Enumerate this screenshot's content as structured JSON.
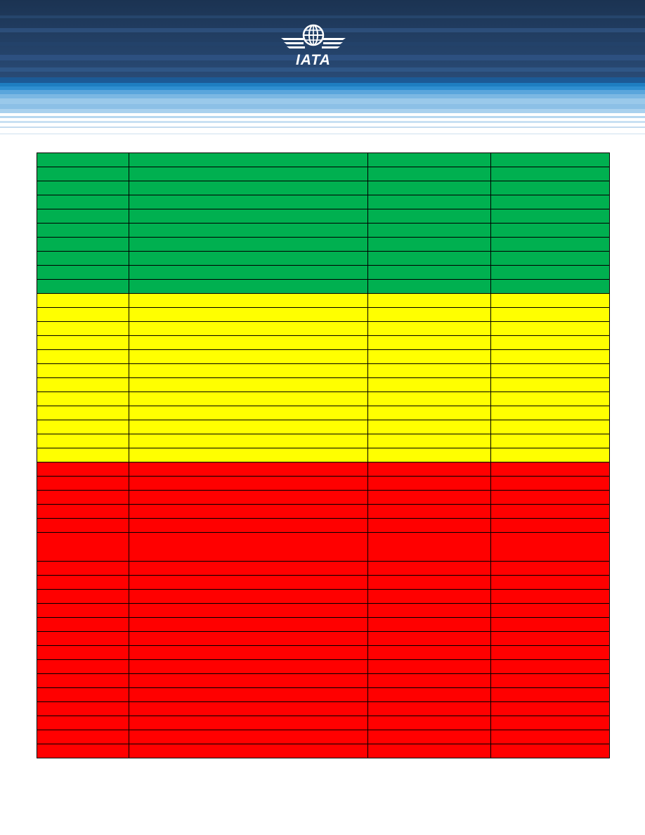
{
  "header": {
    "logo_text": "IATA",
    "colors": {
      "navy": "#1f3a5c",
      "light_blue": "#8fc0e6",
      "accent": "#1a7fc0"
    }
  },
  "table": {
    "colors": {
      "green": "#00b050",
      "yellow": "#ffff00",
      "red": "#ff0000"
    },
    "rows": [
      {
        "status": "green",
        "cells": [
          "",
          "",
          "",
          ""
        ]
      },
      {
        "status": "green",
        "cells": [
          "",
          "",
          "",
          ""
        ]
      },
      {
        "status": "green",
        "cells": [
          "",
          "",
          "",
          ""
        ]
      },
      {
        "status": "green",
        "cells": [
          "",
          "",
          "",
          ""
        ]
      },
      {
        "status": "green",
        "cells": [
          "",
          "",
          "",
          ""
        ]
      },
      {
        "status": "green",
        "cells": [
          "",
          "",
          "",
          ""
        ]
      },
      {
        "status": "green",
        "cells": [
          "",
          "",
          "",
          ""
        ]
      },
      {
        "status": "green",
        "cells": [
          "",
          "",
          "",
          ""
        ]
      },
      {
        "status": "green",
        "cells": [
          "",
          "",
          "",
          ""
        ]
      },
      {
        "status": "green",
        "cells": [
          "",
          "",
          "",
          ""
        ]
      },
      {
        "status": "yellow",
        "cells": [
          "",
          "",
          "",
          ""
        ]
      },
      {
        "status": "yellow",
        "cells": [
          "",
          "",
          "",
          ""
        ]
      },
      {
        "status": "yellow",
        "cells": [
          "",
          "",
          "",
          ""
        ]
      },
      {
        "status": "yellow",
        "cells": [
          "",
          "",
          "",
          ""
        ]
      },
      {
        "status": "yellow",
        "cells": [
          "",
          "",
          "",
          ""
        ]
      },
      {
        "status": "yellow",
        "cells": [
          "",
          "",
          "",
          ""
        ]
      },
      {
        "status": "yellow",
        "cells": [
          "",
          "",
          "",
          ""
        ]
      },
      {
        "status": "yellow",
        "cells": [
          "",
          "",
          "",
          ""
        ]
      },
      {
        "status": "yellow",
        "cells": [
          "",
          "",
          "",
          ""
        ]
      },
      {
        "status": "yellow",
        "cells": [
          "",
          "",
          "",
          ""
        ]
      },
      {
        "status": "yellow",
        "cells": [
          "",
          "",
          "",
          ""
        ]
      },
      {
        "status": "yellow",
        "cells": [
          "",
          "",
          "",
          ""
        ]
      },
      {
        "status": "red",
        "cells": [
          "",
          "",
          "",
          ""
        ]
      },
      {
        "status": "red",
        "cells": [
          "",
          "",
          "",
          ""
        ]
      },
      {
        "status": "red",
        "cells": [
          "",
          "",
          "",
          ""
        ]
      },
      {
        "status": "red",
        "cells": [
          "",
          "",
          "",
          ""
        ]
      },
      {
        "status": "red",
        "cells": [
          "",
          "",
          "",
          ""
        ]
      },
      {
        "status": "red",
        "tall": true,
        "cells": [
          "",
          "",
          "",
          ""
        ]
      },
      {
        "status": "red",
        "cells": [
          "",
          "",
          "",
          ""
        ]
      },
      {
        "status": "red",
        "cells": [
          "",
          "",
          "",
          ""
        ]
      },
      {
        "status": "red",
        "cells": [
          "",
          "",
          "",
          ""
        ]
      },
      {
        "status": "red",
        "cells": [
          "",
          "",
          "",
          ""
        ]
      },
      {
        "status": "red",
        "cells": [
          "",
          "",
          "",
          ""
        ]
      },
      {
        "status": "red",
        "cells": [
          "",
          "",
          "",
          ""
        ]
      },
      {
        "status": "red",
        "cells": [
          "",
          "",
          "",
          ""
        ]
      },
      {
        "status": "red",
        "cells": [
          "",
          "",
          "",
          ""
        ]
      },
      {
        "status": "red",
        "cells": [
          "",
          "",
          "",
          ""
        ]
      },
      {
        "status": "red",
        "cells": [
          "",
          "",
          "",
          ""
        ]
      },
      {
        "status": "red",
        "cells": [
          "",
          "",
          "",
          ""
        ]
      },
      {
        "status": "red",
        "cells": [
          "",
          "",
          "",
          ""
        ]
      },
      {
        "status": "red",
        "cells": [
          "",
          "",
          "",
          ""
        ]
      },
      {
        "status": "red",
        "cells": [
          "",
          "",
          "",
          ""
        ]
      }
    ]
  }
}
